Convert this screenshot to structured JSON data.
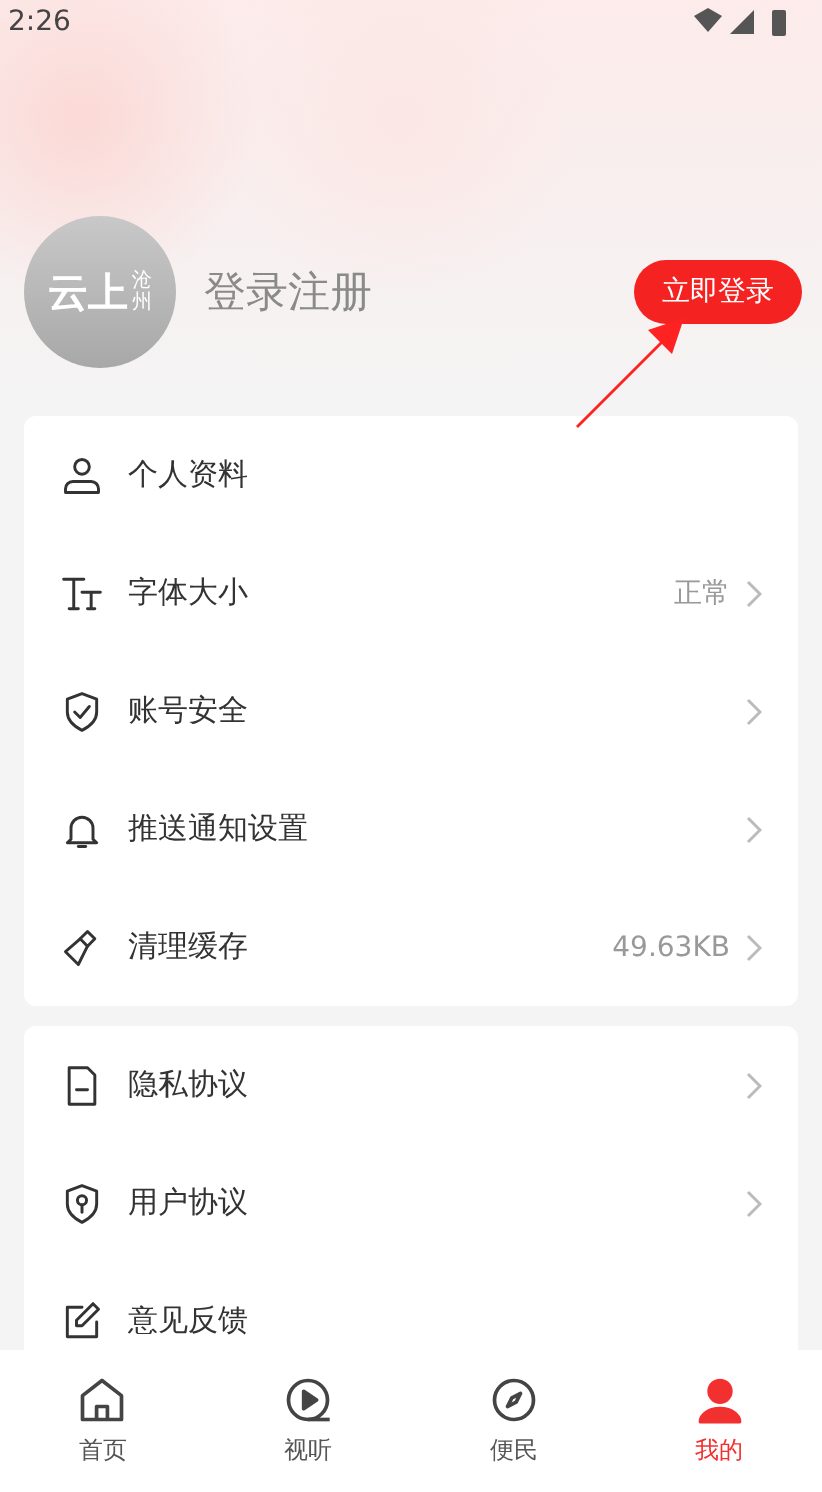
{
  "status_bar": {
    "time": "2:26"
  },
  "profile": {
    "logo_main": "云上",
    "logo_side": "沧州",
    "name": "登录注册",
    "login_button": "立即登录"
  },
  "settings_groups": [
    {
      "items": [
        {
          "label": "个人资料",
          "chevron": false
        },
        {
          "label": "字体大小",
          "value": "正常",
          "chevron": true
        },
        {
          "label": "账号安全",
          "chevron": true
        },
        {
          "label": "推送通知设置",
          "chevron": true
        },
        {
          "label": "清理缓存",
          "value": "49.63KB",
          "chevron": true
        }
      ]
    },
    {
      "items": [
        {
          "label": "隐私协议",
          "chevron": true
        },
        {
          "label": "用户协议",
          "chevron": true
        },
        {
          "label": "意见反馈",
          "chevron": false
        }
      ]
    }
  ],
  "bottom_nav": [
    {
      "label": "首页",
      "selected": false
    },
    {
      "label": "视听",
      "selected": false
    },
    {
      "label": "便民",
      "selected": false
    },
    {
      "label": "我的",
      "selected": true
    }
  ]
}
